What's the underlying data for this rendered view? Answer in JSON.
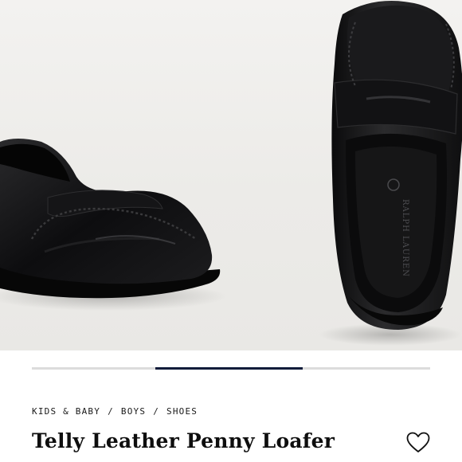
{
  "breadcrumb": {
    "items": [
      "KIDS & BABY",
      "BOYS",
      "SHOES"
    ],
    "separator": "/"
  },
  "product": {
    "title": "Telly Leather Penny Loafer",
    "insole_brand_text": "RALPH LAUREN"
  },
  "gallery": {
    "progress_fraction_start": 0.31,
    "progress_fraction_end": 0.68
  },
  "icons": {
    "wishlist": "heart-outline-icon"
  },
  "colors": {
    "progress_active": "#0f1c3a",
    "progress_track": "#dcdcdc",
    "background": "#ffffff"
  }
}
